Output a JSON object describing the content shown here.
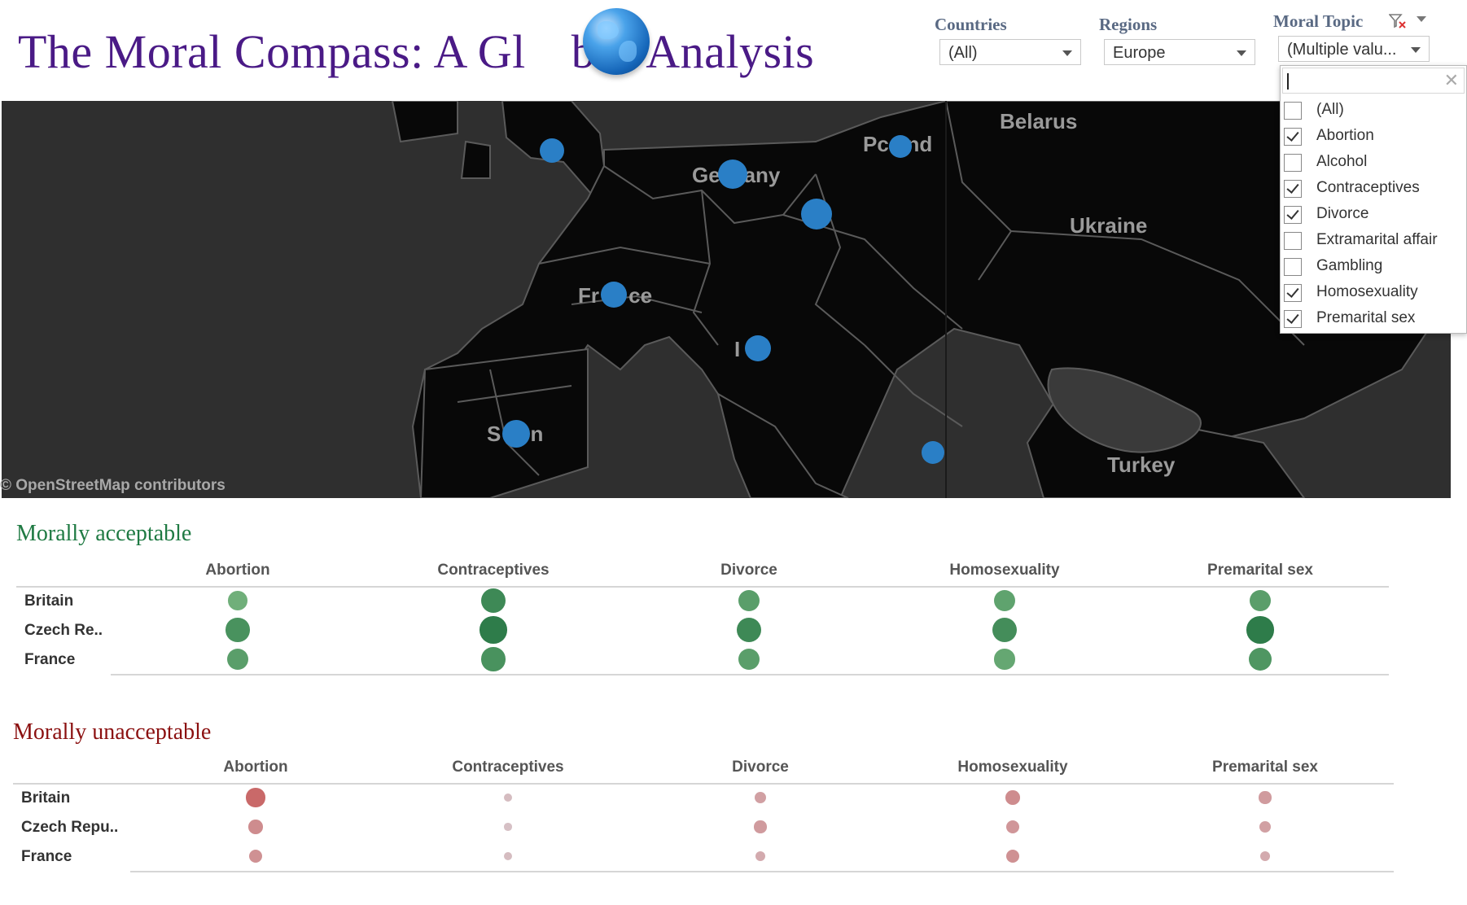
{
  "title": "The Moral Compass: A Gl      b    Analysis",
  "title_parts": {
    "left": "The Moral Compass: A Gl",
    "mid": "b",
    "right": "Analysis"
  },
  "filters": {
    "countries": {
      "label": "Countries",
      "value": "(All)"
    },
    "regions": {
      "label": "Regions",
      "value": "Europe"
    },
    "moral_topic": {
      "label": "Moral Topic",
      "value": "(Multiple valu..."
    }
  },
  "topic_panel": {
    "search_value": "",
    "options": [
      {
        "label": "(All)",
        "checked": false
      },
      {
        "label": "Abortion",
        "checked": true
      },
      {
        "label": "Alcohol",
        "checked": false
      },
      {
        "label": "Contraceptives",
        "checked": true
      },
      {
        "label": "Divorce",
        "checked": true
      },
      {
        "label": "Extramarital affair",
        "checked": false
      },
      {
        "label": "Gambling",
        "checked": false
      },
      {
        "label": "Homosexuality",
        "checked": true
      },
      {
        "label": "Premarital sex",
        "checked": true
      }
    ]
  },
  "map": {
    "attribution": "© OpenStreetMap contributors",
    "labels": [
      "Belarus",
      "Ukraine",
      "Turkey",
      "Pc   nd",
      "Ge    any",
      "Fr     ce",
      "I",
      "S     n"
    ],
    "pin_color": "#2a7fc6"
  },
  "acceptable": {
    "title": "Morally acceptable",
    "title_color": "#1f7a43",
    "columns": [
      "Abortion",
      "Contraceptives",
      "Divorce",
      "Homosexuality",
      "Premarital sex"
    ],
    "rows": [
      "Britain",
      "Czech Re..",
      "France"
    ],
    "values": [
      [
        0.35,
        0.8,
        0.55,
        0.5,
        0.55
      ],
      [
        0.7,
        0.95,
        0.8,
        0.75,
        0.95
      ],
      [
        0.55,
        0.7,
        0.55,
        0.45,
        0.65
      ]
    ]
  },
  "unacceptable": {
    "title": "Morally unacceptable",
    "title_color": "#8b1010",
    "columns": [
      "Abortion",
      "Contraceptives",
      "Divorce",
      "Homosexuality",
      "Premarital sex"
    ],
    "rows": [
      "Britain",
      "Czech Repu..",
      "France"
    ],
    "values": [
      [
        0.95,
        0.12,
        0.4,
        0.6,
        0.45
      ],
      [
        0.6,
        0.08,
        0.45,
        0.5,
        0.4
      ],
      [
        0.55,
        0.12,
        0.3,
        0.55,
        0.3
      ]
    ]
  }
}
